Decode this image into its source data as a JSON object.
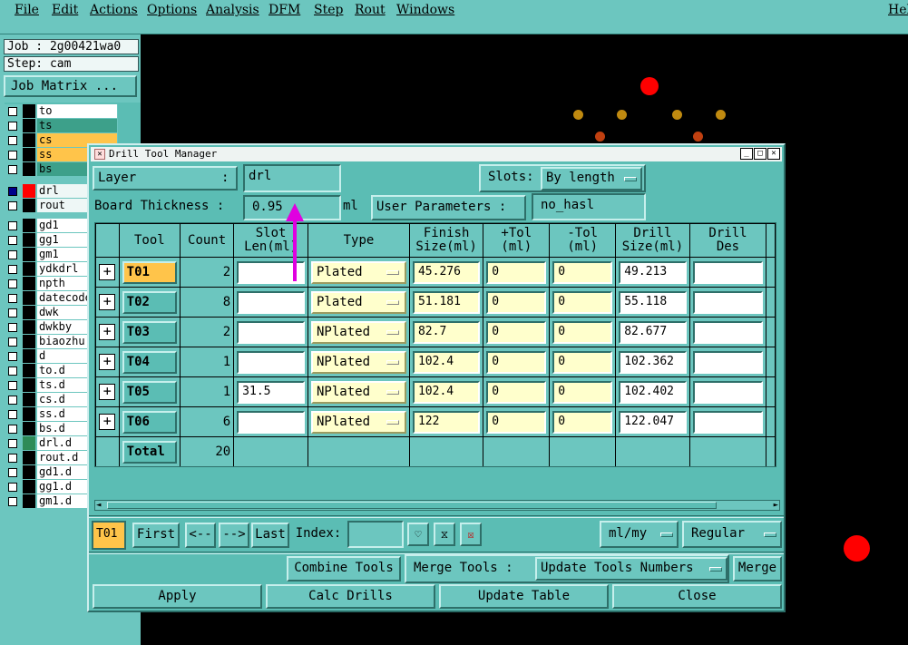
{
  "menu": [
    "File",
    "Edit",
    "Actions",
    "Options",
    "Analysis",
    "DFM",
    "Step",
    "Rout",
    "Windows"
  ],
  "menu_help": "Hel",
  "job_line": "Job : 2g00421wa0",
  "step_line": "Step: cam",
  "job_matrix_button": "Job Matrix ...",
  "layers": [
    "to",
    "ts",
    "cs",
    "ss",
    "bs",
    "drl",
    "rout",
    "gd1",
    "gg1",
    "gm1",
    "ydkdrl",
    "npth",
    "datecode",
    "dwk",
    "dwkby",
    "biaozhu",
    "d",
    "to.d",
    "ts.d",
    "cs.d",
    "ss.d",
    "bs.d",
    "drl.d",
    "rout.d",
    "gd1.d",
    "gg1.d",
    "gm1.d"
  ],
  "colors": {
    "accent": "#6cc6bf",
    "selected_tool": "#ffc44a",
    "field_yellow": "#ffffcc",
    "pad_red": "#ff0000",
    "pad_orange": "#c08a10"
  },
  "dialog": {
    "title": "Drill Tool Manager",
    "layer_label": "Layer",
    "layer_colon": ":",
    "layer_value": "drl",
    "slots_label": "Slots:",
    "slots_value": "By length",
    "board_thickness_label": "Board Thickness :",
    "board_thickness_value": "0.95",
    "board_thickness_unit": "ml",
    "user_params_label": "User Parameters :",
    "user_params_value": "no_hasl",
    "columns": [
      "Tool",
      "Count",
      "Slot\nLen(ml)",
      "Type",
      "Finish\nSize(ml)",
      "+Tol\n(ml)",
      "-Tol\n(ml)",
      "Drill\nSize(ml)",
      "Drill\nDes"
    ],
    "rows": [
      {
        "tool": "T01",
        "count": "2",
        "slot": "",
        "type": "Plated",
        "finish": "45.276",
        "ptol": "0",
        "mtol": "0",
        "drill": "49.213",
        "des": ""
      },
      {
        "tool": "T02",
        "count": "8",
        "slot": "",
        "type": "Plated",
        "finish": "51.181",
        "ptol": "0",
        "mtol": "0",
        "drill": "55.118",
        "des": ""
      },
      {
        "tool": "T03",
        "count": "2",
        "slot": "",
        "type": "NPlated",
        "finish": "82.7",
        "ptol": "0",
        "mtol": "0",
        "drill": "82.677",
        "des": ""
      },
      {
        "tool": "T04",
        "count": "1",
        "slot": "",
        "type": "NPlated",
        "finish": "102.4",
        "ptol": "0",
        "mtol": "0",
        "drill": "102.362",
        "des": ""
      },
      {
        "tool": "T05",
        "count": "1",
        "slot": "31.5",
        "type": "NPlated",
        "finish": "102.4",
        "ptol": "0",
        "mtol": "0",
        "drill": "102.402",
        "des": ""
      },
      {
        "tool": "T06",
        "count": "6",
        "slot": "",
        "type": "NPlated",
        "finish": "122",
        "ptol": "0",
        "mtol": "0",
        "drill": "122.047",
        "des": ""
      }
    ],
    "total_label": "Total",
    "total_value": "20",
    "nav": {
      "current": "T01",
      "first": "First",
      "prev": "<--",
      "next": "-->",
      "last": "Last",
      "index_label": "Index:",
      "index_value": "",
      "units": "ml/my",
      "mode": "Regular"
    },
    "combine_tools": "Combine Tools",
    "merge_tools_label": "Merge Tools :",
    "merge_tools_value": "Update Tools Numbers",
    "merge_button": "Merge",
    "apply": "Apply",
    "calc_drills": "Calc Drills",
    "update_table": "Update Table",
    "close": "Close"
  }
}
